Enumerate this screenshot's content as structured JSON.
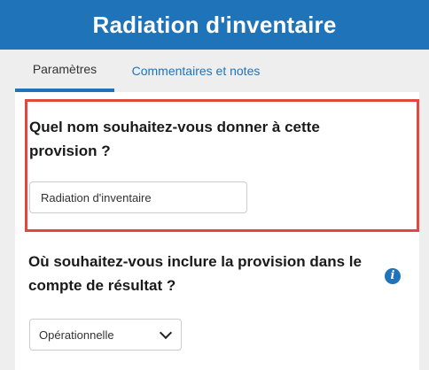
{
  "header": {
    "title": "Radiation d'inventaire"
  },
  "tabs": [
    {
      "label": "Paramètres",
      "active": true
    },
    {
      "label": "Commentaires et notes",
      "active": false
    }
  ],
  "question1": {
    "text": "Quel nom souhaitez-vous donner à cette provision ?",
    "input_value": "Radiation d'inventaire"
  },
  "question2": {
    "text": "Où souhaitez-vous inclure la provision dans le compte de résultat ?",
    "info_icon": "info-icon",
    "select_value": "Opérationnelle"
  },
  "colors": {
    "brand": "#1f73b8",
    "highlight_border": "#e0493f",
    "background": "#eeeeee"
  }
}
